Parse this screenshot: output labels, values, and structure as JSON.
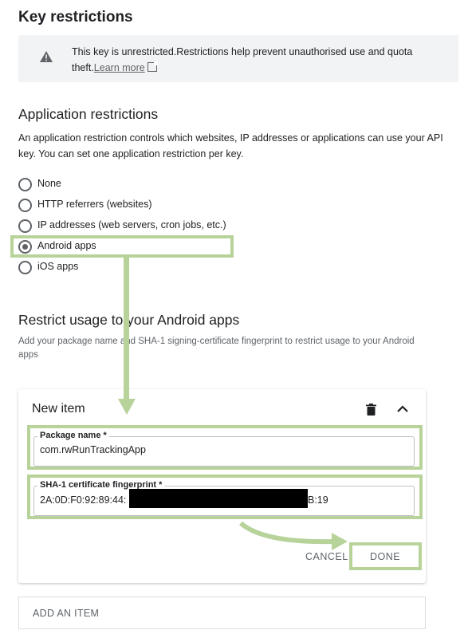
{
  "key_restrictions": {
    "title": "Key restrictions",
    "banner_text": "This key is unrestricted.Restrictions help prevent unauthorised use and quota theft.",
    "banner_link": "Learn more"
  },
  "application_restrictions": {
    "title": "Application restrictions",
    "description": "An application restriction controls which websites, IP addresses or applications can use your API key. You can set one application restriction per key.",
    "options": [
      {
        "label": "None",
        "checked": false
      },
      {
        "label": "HTTP referrers (websites)",
        "checked": false
      },
      {
        "label": "IP addresses (web servers, cron jobs, etc.)",
        "checked": false
      },
      {
        "label": "Android apps",
        "checked": true
      },
      {
        "label": "iOS apps",
        "checked": false
      }
    ]
  },
  "android": {
    "title": "Restrict usage to your Android apps",
    "description": "Add your package name and SHA-1 signing-certificate fingerprint to restrict usage to your Android apps",
    "item": {
      "title": "New item",
      "package_label": "Package name *",
      "package_value": "com.rwRunTrackingApp",
      "sha_label": "SHA-1 certificate fingerprint *",
      "sha_prefix": "2A:0D:F0:92:89:44:",
      "sha_suffix": "B:19",
      "cancel_label": "CANCEL",
      "done_label": "DONE"
    },
    "add_item_label": "ADD AN ITEM"
  },
  "colors": {
    "highlight": "#b7d39a",
    "text": "#202124",
    "muted": "#5f6368"
  }
}
